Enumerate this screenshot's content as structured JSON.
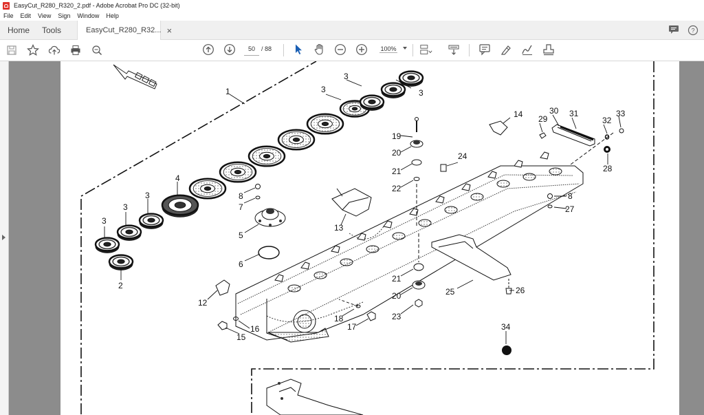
{
  "window": {
    "title": "EasyCut_R280_R320_2.pdf - Adobe Acrobat Pro DC (32-bit)"
  },
  "menu": [
    "File",
    "Edit",
    "View",
    "Sign",
    "Window",
    "Help"
  ],
  "tabs": {
    "home": "Home",
    "tools": "Tools",
    "document": "EasyCut_R280_R32...",
    "close": "×"
  },
  "toolbar": {
    "page_current": "50",
    "page_total": "/ 88",
    "zoom": "100%",
    "icons": [
      "save-icon",
      "bookmark-star-icon",
      "upload-cloud-icon",
      "print-icon",
      "find-zoom-icon",
      "prev-page-icon",
      "next-page-icon",
      "select-cursor-icon",
      "hand-tool-icon",
      "zoom-out-icon",
      "zoom-in-icon",
      "page-fit-icon",
      "scroll-mode-icon",
      "comment-icon",
      "highlight-pen-icon",
      "sign-icon",
      "stamp-icon"
    ]
  },
  "diagram": {
    "callouts": {
      "c1": "1",
      "c2": "2",
      "c3a": "3",
      "c3b": "3",
      "c3c": "3",
      "c3d": "3",
      "c3e": "3",
      "c3f": "3",
      "c4": "4",
      "c5": "5",
      "c6": "6",
      "c7": "7",
      "c8a": "8",
      "c8b": "8",
      "c12": "12",
      "c13": "13",
      "c14": "14",
      "c15": "15",
      "c16": "16",
      "c17": "17",
      "c18": "18",
      "c19": "19",
      "c20a": "20",
      "c20b": "20",
      "c21a": "21",
      "c21b": "21",
      "c22": "22",
      "c23": "23",
      "c24": "24",
      "c25": "25",
      "c26": "26",
      "c27": "27",
      "c28": "28",
      "c29": "29",
      "c30": "30",
      "c31": "31",
      "c32": "32",
      "c33": "33",
      "c34": "34"
    }
  }
}
